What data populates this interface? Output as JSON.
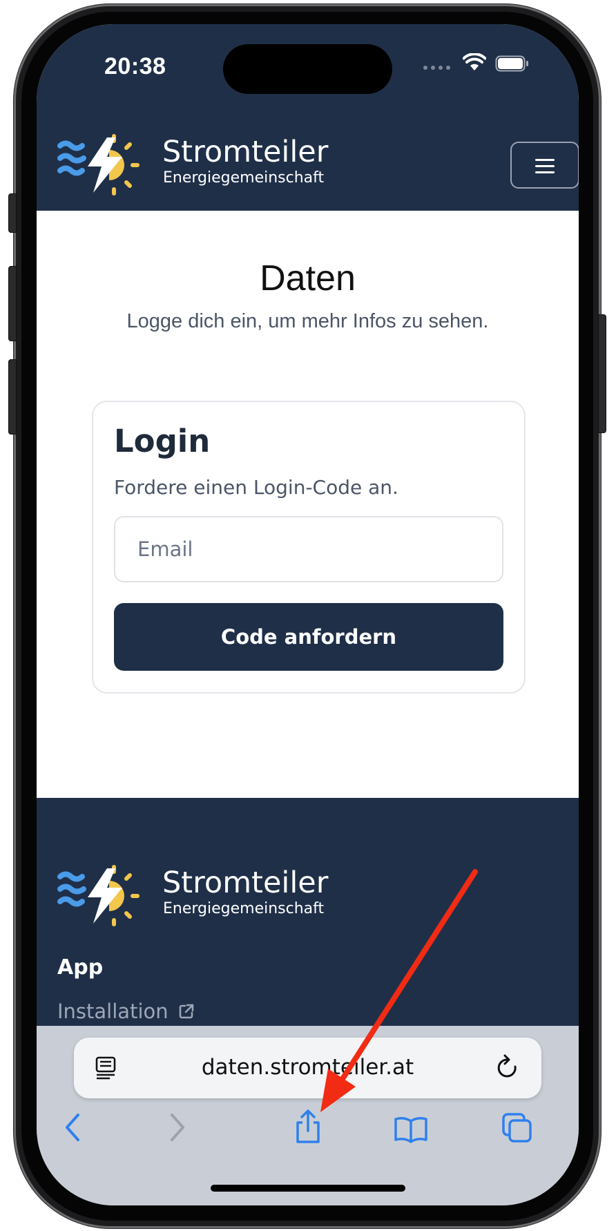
{
  "status_bar": {
    "time": "20:38"
  },
  "brand": {
    "name": "Stromteiler",
    "tagline": "Energiegemeinschaft"
  },
  "main": {
    "title": "Daten",
    "subtitle": "Logge dich ein, um mehr Infos zu sehen."
  },
  "login_card": {
    "title": "Login",
    "subtitle": "Fordere einen Login-Code an.",
    "email_placeholder": "Email",
    "email_value": "",
    "submit_label": "Code anfordern"
  },
  "footer": {
    "heading": "App",
    "links": [
      {
        "label": "Installation",
        "icon": "external-link-icon"
      }
    ]
  },
  "browser": {
    "url": "daten.stromteiler.at",
    "toolbar_icons": [
      "back-icon",
      "forward-icon",
      "share-icon",
      "bookmarks-icon",
      "tabs-icon"
    ]
  },
  "colors": {
    "navy": "#1f2f48",
    "wave_blue": "#4a9be8",
    "sun_yellow": "#f3c64c",
    "safari_blue": "#2f80ed",
    "annotation_red": "#f22b14"
  }
}
